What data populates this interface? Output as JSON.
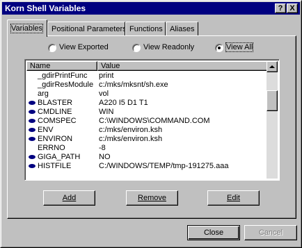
{
  "window": {
    "title": "Korn Shell Variables"
  },
  "titlebar": {
    "help_label": "?",
    "close_label": "X"
  },
  "tabs": [
    {
      "label": "Variables",
      "active": true
    },
    {
      "label": "Positional Parameters",
      "active": false
    },
    {
      "label": "Functions",
      "active": false
    },
    {
      "label": "Aliases",
      "active": false
    }
  ],
  "view_options": [
    {
      "label": "View Exported",
      "selected": false
    },
    {
      "label": "View Readonly",
      "selected": false
    },
    {
      "label": "View All",
      "selected": true
    }
  ],
  "list": {
    "columns": [
      "Name",
      "Value"
    ],
    "rows": [
      {
        "name": "_gdirPrintFunc",
        "value": "print",
        "exported": false
      },
      {
        "name": "_gdirResModule",
        "value": "c:/mks/mksnt/sh.exe",
        "exported": false
      },
      {
        "name": "arg",
        "value": "vol",
        "exported": false
      },
      {
        "name": "BLASTER",
        "value": "A220 I5 D1 T1",
        "exported": true
      },
      {
        "name": "CMDLINE",
        "value": "WIN",
        "exported": true
      },
      {
        "name": "COMSPEC",
        "value": "C:\\WINDOWS\\COMMAND.COM",
        "exported": true
      },
      {
        "name": "ENV",
        "value": "c:/mks/environ.ksh",
        "exported": true
      },
      {
        "name": "ENVIRON",
        "value": "c:/mks/environ.ksh",
        "exported": true
      },
      {
        "name": "ERRNO",
        "value": "-8",
        "exported": false
      },
      {
        "name": "GIGA_PATH",
        "value": "NO",
        "exported": true
      },
      {
        "name": "HISTFILE",
        "value": "C:/WINDOWS/TEMP/tmp-191275.aaa",
        "exported": true
      }
    ]
  },
  "buttons": {
    "add": "Add",
    "remove": "Remove",
    "edit": "Edit",
    "close": "Close",
    "cancel": "Cancel"
  },
  "colors": {
    "titlebar": "#000080",
    "face": "#c0c0c0",
    "bullet": "#000080"
  }
}
